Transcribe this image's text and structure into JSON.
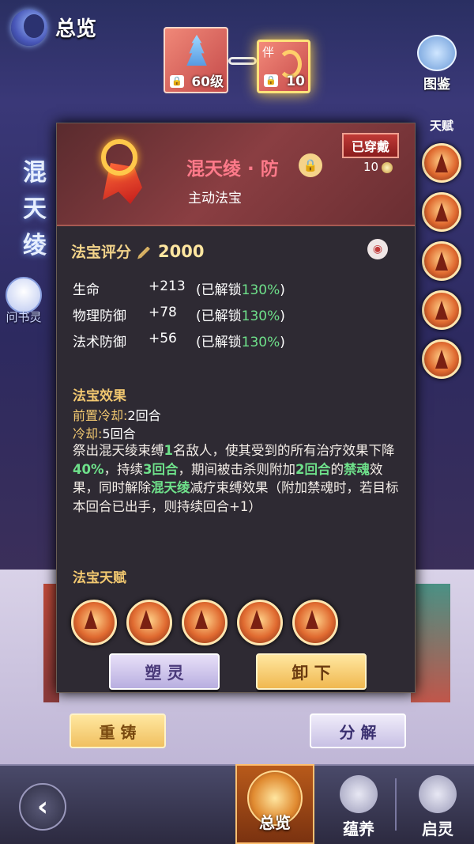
{
  "header": {
    "title": "总览",
    "tujian_label": "图鉴"
  },
  "top_slots": {
    "tower_level": "60级",
    "companion_badge": "伴",
    "companion_level": "10"
  },
  "vertical_title": "混天绫",
  "side": {
    "wenshuling_label": "问书灵",
    "talent_header": "天赋"
  },
  "panel": {
    "equipped_tag": "已穿戴",
    "name": "混天绫 · 防",
    "level": "10",
    "type": "主动法宝",
    "score_label": "法宝评分",
    "score_value": "2000",
    "stats": [
      {
        "name": "生命",
        "value": "+213",
        "pre": "(已解锁",
        "pct": "130%",
        "post": ")"
      },
      {
        "name": "物理防御",
        "value": "+78",
        "pre": "(已解锁",
        "pct": "130%",
        "post": ")"
      },
      {
        "name": "法术防御",
        "value": "+56",
        "pre": "(已解锁",
        "pct": "130%",
        "post": ")"
      }
    ],
    "effect_header": "法宝效果",
    "pre_cd_label": "前置冷却:",
    "pre_cd_value": "2回合",
    "cd_label": "冷却:",
    "cd_value": "5回合",
    "desc": {
      "p1": "祭出混天绫束缚",
      "h1": "1",
      "p2": "名敌人，使其受到的所有治疗效果下降",
      "h2": "40%",
      "p3": "，持续",
      "h3": "3回合",
      "p4": "，期间被击杀则附加",
      "h4": "2回合",
      "p5": "的",
      "h5": "禁魂",
      "p6": "效果，同时解除",
      "h6": "混天绫",
      "p7": "减疗束缚效果（附加禁魂时，若目标本回合已出手，则持续回合+1）"
    },
    "talent_header": "法宝天赋",
    "btn_shape": "塑 灵",
    "btn_remove": "卸 下"
  },
  "actions": {
    "recast": "重 铸",
    "decompose": "分 解"
  },
  "bottom_nav": {
    "back_icon": "‹",
    "overview": "总览",
    "nurture": "蕴养",
    "awaken": "启灵"
  },
  "colors": {
    "highlight_green": "#6ee08a",
    "gold": "#f2c870",
    "name_pink": "#ff7a8a"
  }
}
